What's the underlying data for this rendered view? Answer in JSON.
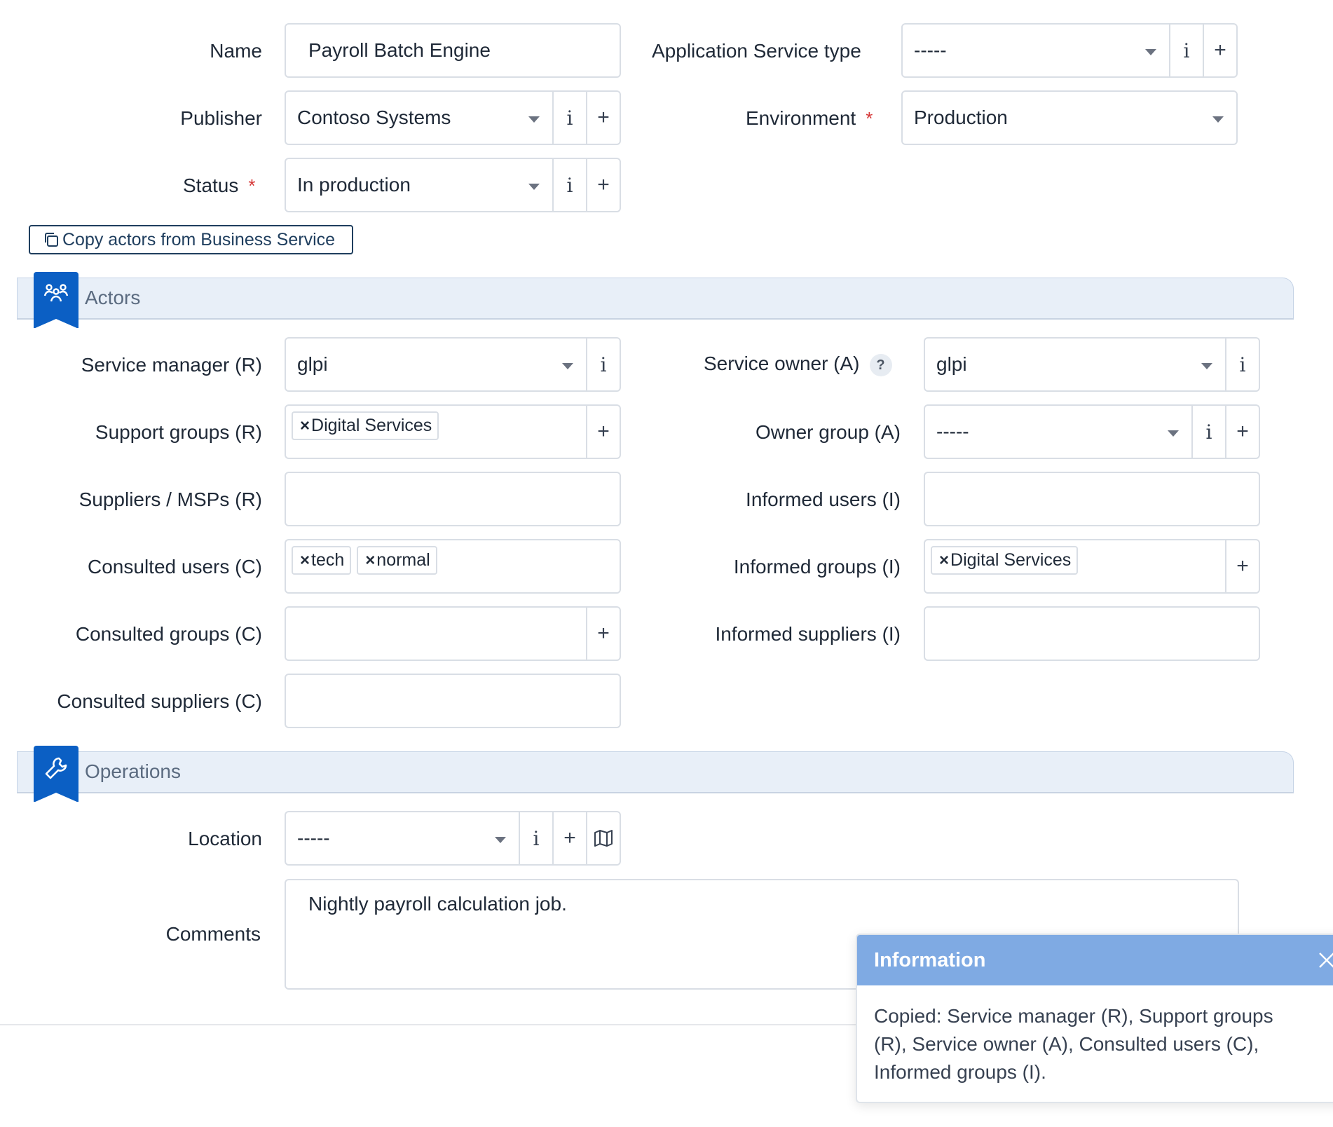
{
  "fields": {
    "name": {
      "label": "Name",
      "value": "Payroll Batch Engine"
    },
    "app_type": {
      "label": "Application Service type",
      "value": "-----"
    },
    "publisher": {
      "label": "Publisher",
      "value": "Contoso Systems"
    },
    "environment": {
      "label": "Environment",
      "value": "Production",
      "required": "*"
    },
    "status": {
      "label": "Status",
      "value": "In production",
      "required": "*"
    }
  },
  "copy_button": {
    "label": "Copy actors from Business Service"
  },
  "sections": {
    "actors": "Actors",
    "operations": "Operations"
  },
  "actors": {
    "service_manager": {
      "label": "Service manager (R)",
      "value": "glpi"
    },
    "service_owner": {
      "label": "Service owner (A)",
      "value": "glpi",
      "help": "?"
    },
    "support_groups": {
      "label": "Support groups (R)",
      "tags": [
        "Digital Services"
      ]
    },
    "owner_group": {
      "label": "Owner group (A)",
      "value": "-----"
    },
    "suppliers": {
      "label": "Suppliers / MSPs (R)"
    },
    "informed_users": {
      "label": "Informed users (I)"
    },
    "consulted_users": {
      "label": "Consulted users (C)",
      "tags": [
        "tech",
        "normal"
      ]
    },
    "informed_groups": {
      "label": "Informed groups (I)",
      "tags": [
        "Digital Services"
      ]
    },
    "consulted_groups": {
      "label": "Consulted groups (C)"
    },
    "informed_suppliers": {
      "label": "Informed suppliers (I)"
    },
    "consulted_suppliers": {
      "label": "Consulted suppliers (C)"
    }
  },
  "operations": {
    "location": {
      "label": "Location",
      "value": "-----"
    },
    "comments": {
      "label": "Comments",
      "value": "Nightly payroll calculation job."
    }
  },
  "buttons": {
    "info": "i",
    "add": "+",
    "remove": "×"
  },
  "toast": {
    "title": "Information",
    "message": "Copied: Service manager (R), Support groups (R), Service owner (A), Consulted users (C), Informed groups (I)."
  },
  "colors": {
    "accent": "#0b5fc4",
    "section_bg": "#e8eff8",
    "toast_header": "#7faae3",
    "required": "#d63939"
  },
  "icons": {
    "actors": "users-icon",
    "operations": "wrench-icon",
    "copy": "copy-icon",
    "map": "map-icon",
    "close": "close-icon"
  }
}
